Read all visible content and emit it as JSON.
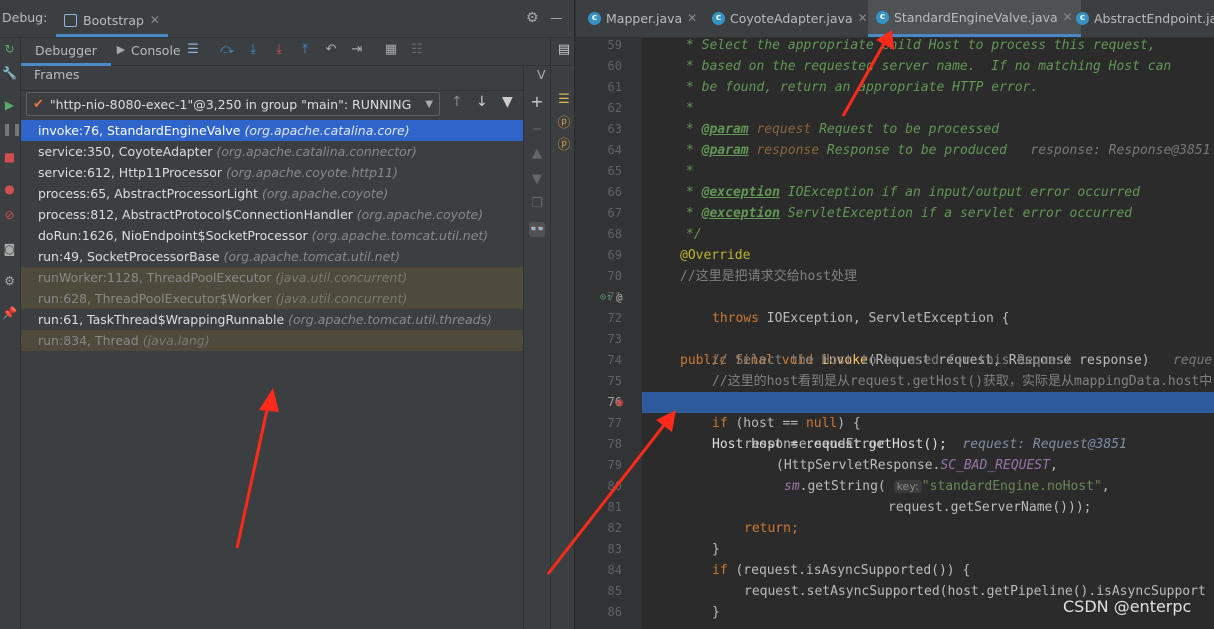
{
  "debug_panel": {
    "title": "Debug:",
    "session_tab": "Bootstrap",
    "tabs": [
      "Debugger",
      "Console"
    ],
    "frames_label": "Frames",
    "variables_label": "V",
    "thread": "\"http-nio-8080-exec-1\"@3,250 in group \"main\": RUNNING",
    "frames": [
      {
        "method": "invoke:76, StandardEngineValve",
        "pkg": "(org.apache.catalina.core)",
        "state": "selected"
      },
      {
        "method": "service:350, CoyoteAdapter",
        "pkg": "(org.apache.catalina.connector)",
        "state": "normal"
      },
      {
        "method": "service:612, Http11Processor",
        "pkg": "(org.apache.coyote.http11)",
        "state": "normal"
      },
      {
        "method": "process:65, AbstractProcessorLight",
        "pkg": "(org.apache.coyote)",
        "state": "normal"
      },
      {
        "method": "process:812, AbstractProtocol$ConnectionHandler",
        "pkg": "(org.apache.coyote)",
        "state": "normal"
      },
      {
        "method": "doRun:1626, NioEndpoint$SocketProcessor",
        "pkg": "(org.apache.tomcat.util.net)",
        "state": "normal"
      },
      {
        "method": "run:49, SocketProcessorBase",
        "pkg": "(org.apache.tomcat.util.net)",
        "state": "normal"
      },
      {
        "method": "runWorker:1128, ThreadPoolExecutor",
        "pkg": "(java.util.concurrent)",
        "state": "library"
      },
      {
        "method": "run:628, ThreadPoolExecutor$Worker",
        "pkg": "(java.util.concurrent)",
        "state": "library"
      },
      {
        "method": "run:61, TaskThread$WrappingRunnable",
        "pkg": "(org.apache.tomcat.util.threads)",
        "state": "normal"
      },
      {
        "method": "run:834, Thread",
        "pkg": "(java.lang)",
        "state": "library"
      }
    ]
  },
  "editor": {
    "tabs": [
      {
        "label": "Mapper.java",
        "active": false
      },
      {
        "label": "CoyoteAdapter.java",
        "active": false
      },
      {
        "label": "StandardEngineValve.java",
        "active": true
      },
      {
        "label": "AbstractEndpoint.ja",
        "active": false
      }
    ],
    "lines": {
      "n59": "59",
      "n60": "60",
      "n61": "61",
      "n62": "62",
      "n63": "63",
      "n64": "64",
      "n65": "65",
      "n66": "66",
      "n67": "67",
      "n68": "68",
      "n69": "69",
      "n70": "70",
      "n71": "71",
      "n72": "72",
      "n73": "73",
      "n74": "74",
      "n75": "75",
      "n76": "76",
      "n77": "77",
      "n78": "78",
      "n79": "79",
      "n80": "80",
      "n81": "81",
      "n82": "82",
      "n83": "83",
      "n84": "84",
      "n85": "85",
      "n86": "86",
      "l59": "* Select the appropriate child Host to process this request,",
      "l60": "* based on the requested server name.  If no matching Host can",
      "l61": "* be found, return an appropriate HTTP error.",
      "l62": "*",
      "l63_tag": "@param",
      "l63_name": "request",
      "l63_desc": "Request to be processed",
      "l64_tag": "@param",
      "l64_name": "response",
      "l64_desc": "Response to be produced",
      "l64_hint": "response: Response@3851",
      "l65": "*",
      "l66_tag": "@exception",
      "l66_desc": "IOException if an input/output error occurred",
      "l67_tag": "@exception",
      "l67_desc": "ServletException if a servlet error occurred",
      "l68": "*/",
      "l69": "@Override",
      "l70": "//这里是把请求交给host处理",
      "l71_kw": "public final void",
      "l71_fn": "invoke",
      "l71_rest": "(Request request, Response response)",
      "l71_hint": "reque",
      "l72_kw": "throws",
      "l72_rest": "IOException, ServletException {",
      "l74": "// Select the Host to be used for this Request",
      "l75": "//这里的host看到是从request.getHost()获取，实际是从mappingData.host中",
      "l76": "Host host = request.getHost();",
      "l76_hint": "request: Request@3851",
      "l77_kw": "if",
      "l77_a": "(host ==",
      "l77_null": "null",
      "l77_b": ") {",
      "l78": "response.sendError",
      "l79_a": "(HttpServletResponse.",
      "l79_static": "SC_BAD_REQUEST",
      "l79_b": ",",
      "l80_sm": "sm",
      "l80_a": ".getString(",
      "l80_key": "key:",
      "l80_str": "\"standardEngine.noHost\"",
      "l80_b": ",",
      "l81": "request.getServerName()));",
      "l82": "return;",
      "l83": "}",
      "l84_kw": "if",
      "l84_rest": "(request.isAsyncSupported()) {",
      "l85": "request.setAsyncSupported(host.getPipeline().isAsyncSupport",
      "l86": "}"
    }
  },
  "watermark": "CSDN @enterpc",
  "colors": {
    "accent": "#2f65ca",
    "annotation_arrow": "#ff2a1a",
    "breakpoint": "#d24d4d"
  }
}
